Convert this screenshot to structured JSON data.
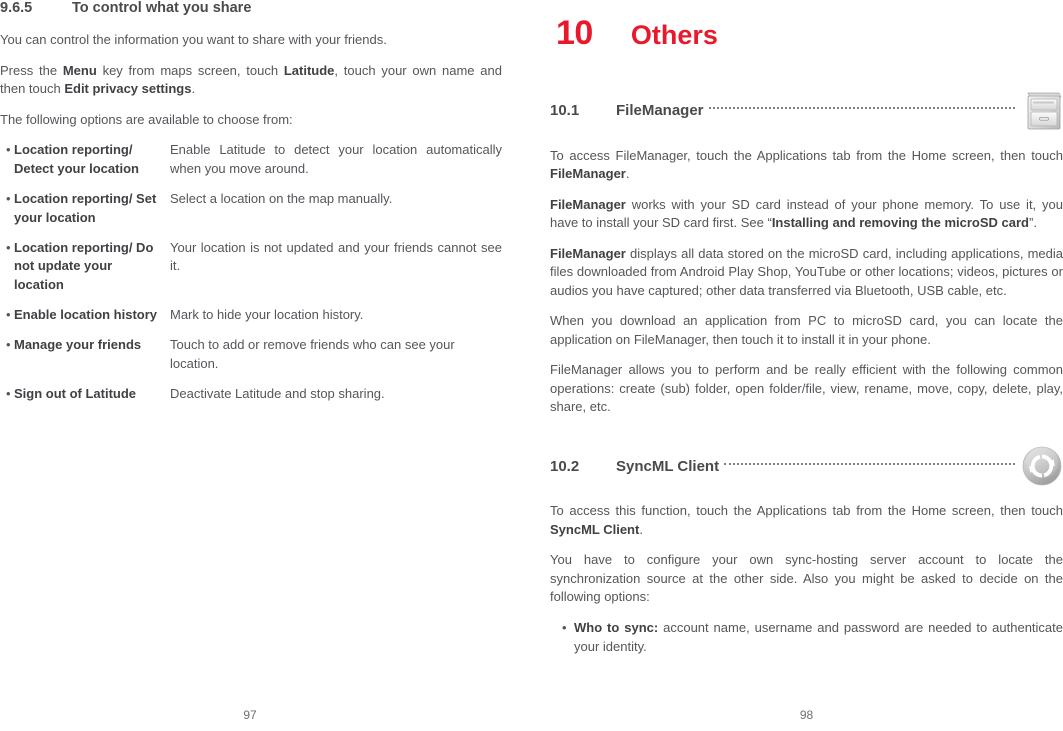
{
  "document": {
    "accent_red": "#E8192C",
    "text_color": "#53565a",
    "heading_color": "#4a4a4a"
  },
  "left_page": {
    "page_number": "97",
    "heading": {
      "number": "9.6.5",
      "title": "To control what you share"
    },
    "paragraphs": {
      "p1": "You can control the information you want to share with your friends.",
      "p2_part1": "Press the ",
      "p2_bold1": "Menu",
      "p2_part2": " key from maps screen, touch ",
      "p2_bold2": "Latitude",
      "p2_part3": ", touch your own name and then touch ",
      "p2_bold3": "Edit privacy settings",
      "p2_part4": ".",
      "p3": "The following options are available to choose from:"
    },
    "options": [
      {
        "bullet": "•",
        "term": "Location reporting/ Detect your location",
        "desc": "Enable Latitude to detect your location automatically when you move around."
      },
      {
        "bullet": "•",
        "term": "Location reporting/ Set your location",
        "desc": "Select a location on the map manually."
      },
      {
        "bullet": "•",
        "term": "Location reporting/ Do not update your location",
        "desc": "Your location is not updated and your friends cannot see it."
      },
      {
        "bullet": "•",
        "term": "Enable location history",
        "desc": "Mark to hide your location history."
      },
      {
        "bullet": "•",
        "term": "Manage your friends",
        "desc": "Touch to add or remove friends who can see your location."
      },
      {
        "bullet": "•",
        "term": "Sign out of Latitude",
        "desc": "Deactivate Latitude and stop sharing."
      }
    ]
  },
  "right_page": {
    "page_number": "98",
    "chapter": {
      "number": "10",
      "name": "Others"
    },
    "section_1": {
      "number": "10.1",
      "title": "FileManager",
      "icon": "file-manager-icon",
      "paragraphs": {
        "p1_part1": "To access FileManager, touch the Applications tab from the Home screen, then touch ",
        "p1_bold1": "FileManager",
        "p1_part2": ".",
        "p2_bold1": "FileManager",
        "p2_part1": " works with your SD card instead of your phone memory. To use it, you have to install your SD card first. See “",
        "p2_bold2": "Installing and removing the microSD card",
        "p2_part2": "”.",
        "p3_bold1": "FileManager",
        "p3_part1": " displays all data stored on the microSD card, including applications, media files downloaded from Android Play Shop, YouTube or other locations; videos, pictures or audios you have captured; other data transferred via Bluetooth, USB cable, etc.",
        "p4": "When you download an application from PC to microSD card, you can locate the application on FileManager, then touch it to install it in your phone.",
        "p5": "FileManager allows you to perform and be really efficient with the following common operations: create (sub) folder, open folder/file, view, rename, move, copy, delete, play, share, etc."
      }
    },
    "section_2": {
      "number": "10.2",
      "title": "SyncML Client",
      "icon": "sync-icon",
      "paragraphs": {
        "p1_part1": "To access this function, touch the Applications tab from the Home screen, then touch ",
        "p1_bold1": "SyncML Client",
        "p1_part2": ".",
        "p2": "You have to configure your own sync-hosting server account to locate the synchronization source at the other side. Also you might be asked to decide on the following options:"
      },
      "options": [
        {
          "bullet": "•",
          "term": "Who to sync:",
          "desc": " account name, username and password are needed to authenticate your identity."
        }
      ]
    }
  }
}
